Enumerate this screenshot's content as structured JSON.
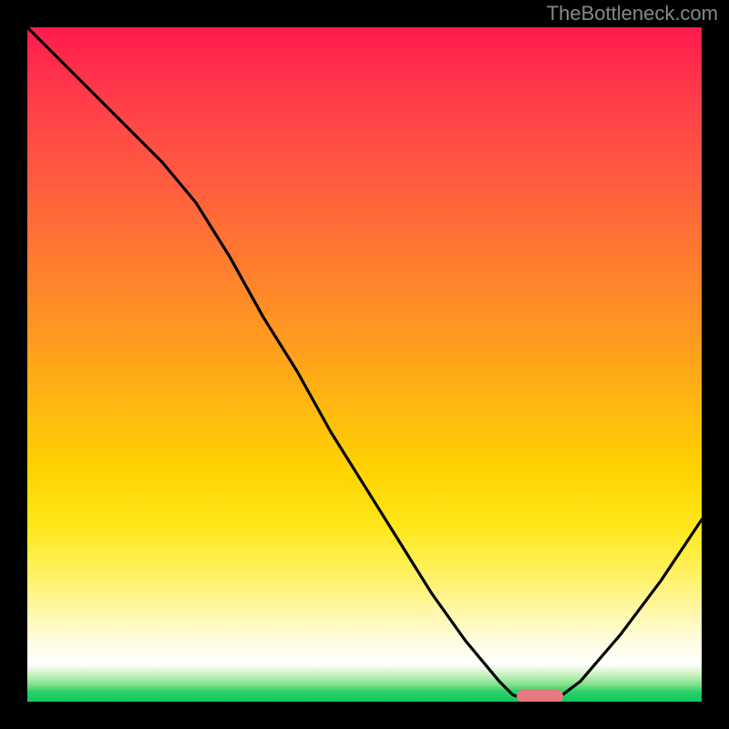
{
  "watermark": "TheBottleneck.com",
  "colors": {
    "frame": "#000000",
    "curve": "#000000",
    "marker": "#e67a7f",
    "gradient_top": "#ff1a4d",
    "gradient_bottom": "#12c85f"
  },
  "chart_data": {
    "type": "line",
    "title": "",
    "xlabel": "",
    "ylabel": "",
    "xlim": [
      0,
      100
    ],
    "ylim": [
      0,
      100
    ],
    "grid": false,
    "series": [
      {
        "name": "curve",
        "x": [
          0,
          10,
          20,
          25,
          30,
          35,
          40,
          45,
          50,
          55,
          60,
          65,
          70,
          72,
          75,
          78,
          82,
          88,
          94,
          100
        ],
        "values": [
          100,
          90,
          80,
          74,
          66,
          57,
          49,
          40,
          32,
          24,
          16,
          9,
          3,
          1,
          0,
          0,
          3,
          10,
          18,
          27
        ]
      }
    ],
    "marker": {
      "x_center": 76,
      "y": 0.5,
      "width_pct": 7
    },
    "background": "vertical_gradient_red_to_green"
  }
}
